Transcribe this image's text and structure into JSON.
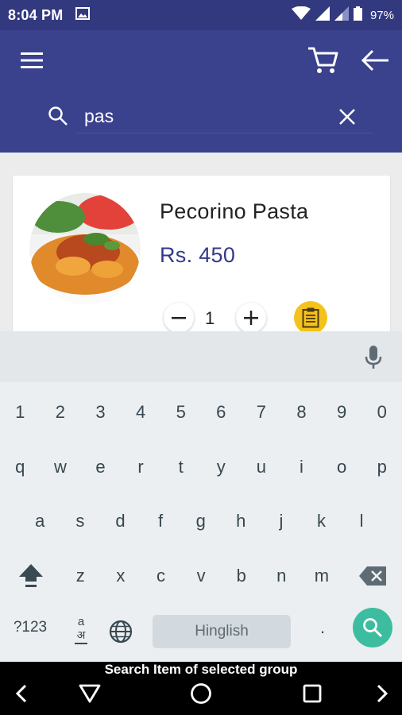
{
  "status_bar": {
    "time": "8:04 PM",
    "battery": "97%",
    "icons": [
      "image-icon",
      "wifi-icon",
      "signal-icon",
      "signal-icon",
      "battery-icon"
    ]
  },
  "toolbar": {
    "icons": [
      "menu-icon",
      "cart-icon",
      "back-arrow-icon"
    ],
    "color": "#3a418d"
  },
  "search": {
    "value": "pas",
    "icons": [
      "search-icon",
      "clear-icon"
    ]
  },
  "product": {
    "name": "Pecorino Pasta",
    "price": "Rs. 450",
    "quantity": "1",
    "price_color": "#33398a",
    "note_color": "#f4c21d"
  },
  "keyboard": {
    "number_row": [
      "1",
      "2",
      "3",
      "4",
      "5",
      "6",
      "7",
      "8",
      "9",
      "0"
    ],
    "row1": [
      "q",
      "w",
      "e",
      "r",
      "t",
      "y",
      "u",
      "i",
      "o",
      "p"
    ],
    "row2": [
      "a",
      "s",
      "d",
      "f",
      "g",
      "h",
      "j",
      "k",
      "l"
    ],
    "row3": [
      "z",
      "x",
      "c",
      "v",
      "b",
      "n",
      "m"
    ],
    "symbols_label": "?123",
    "lang_glyph_top": "a",
    "lang_glyph_bottom": "अ",
    "space_label": "Hinglish",
    "period_label": ".",
    "accent_color": "#3dbd9f"
  },
  "nav_bar": {
    "hint": "Search Item of selected group"
  }
}
